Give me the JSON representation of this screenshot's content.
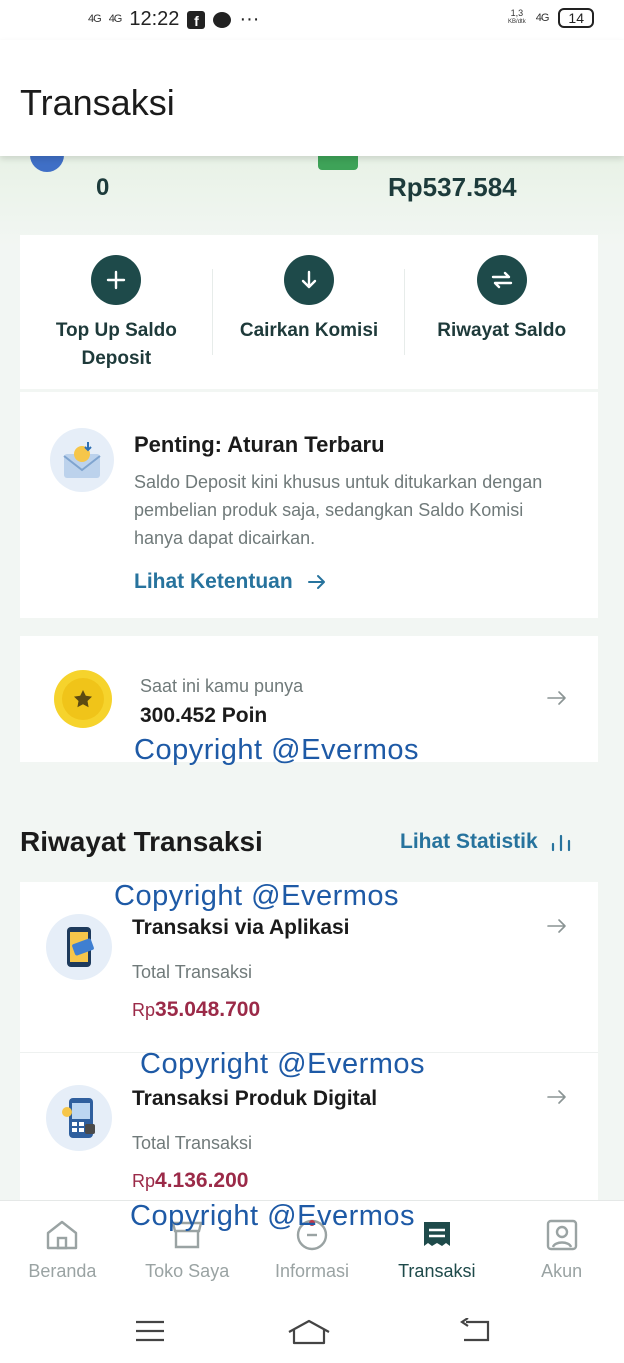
{
  "status_bar": {
    "signal_1": "4G",
    "signal_2": "4G",
    "time": "12:22",
    "more": "···",
    "net_speed_value": "1,3",
    "net_speed_unit": "KB/dtk",
    "network": "4G",
    "battery": "14"
  },
  "header": {
    "title": "Transaksi"
  },
  "balance": {
    "left_value": "0",
    "right_value": "Rp537.584"
  },
  "actions": [
    {
      "label": "Top Up Saldo Deposit",
      "icon": "plus-icon"
    },
    {
      "label": "Cairkan Komisi",
      "icon": "arrow-down-icon"
    },
    {
      "label": "Riwayat Saldo",
      "icon": "swap-icon"
    }
  ],
  "notice": {
    "title": "Penting: Aturan Terbaru",
    "body": "Saldo Deposit kini khusus untuk ditukarkan dengan pembelian produk saja, sedangkan Saldo Komisi hanya dapat dicairkan.",
    "link": "Lihat Ketentuan"
  },
  "points": {
    "label": "Saat ini kamu punya",
    "value": "300.452 Poin"
  },
  "watermark": "Copyright @Evermos",
  "history": {
    "title": "Riwayat Transaksi",
    "stat_link": "Lihat Statistik",
    "items": [
      {
        "title": "Transaksi via Aplikasi",
        "label": "Total Transaksi",
        "currency": "Rp",
        "amount": "35.048.700"
      },
      {
        "title": "Transaksi Produk Digital",
        "label": "Total Transaksi",
        "currency": "Rp",
        "amount": "4.136.200"
      }
    ]
  },
  "nav": [
    {
      "label": "Beranda",
      "icon": "home-icon"
    },
    {
      "label": "Toko Saya",
      "icon": "store-icon"
    },
    {
      "label": "Informasi",
      "icon": "info-icon"
    },
    {
      "label": "Transaksi",
      "icon": "transaction-icon",
      "active": true
    },
    {
      "label": "Akun",
      "icon": "account-icon"
    }
  ],
  "colors": {
    "primary_dark": "#1e4a4a",
    "link": "#27739d",
    "amount": "#9b2a48",
    "watermark": "#1e5aa6"
  }
}
